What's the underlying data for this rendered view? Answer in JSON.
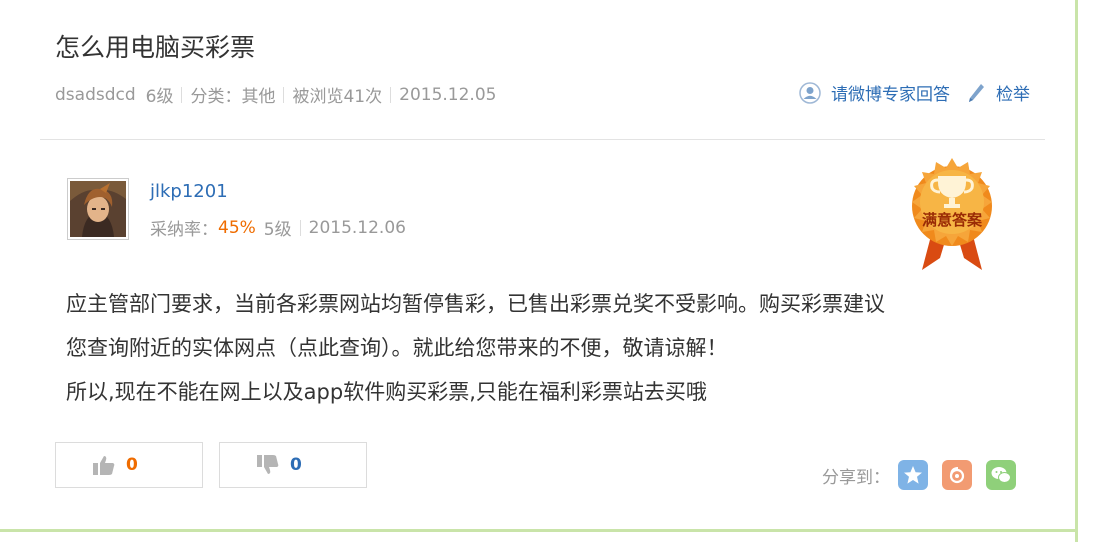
{
  "question": {
    "title": "怎么用电脑买彩票",
    "author": "dsadsdcd",
    "author_level": "6级",
    "category": "分类：其他",
    "views": "被浏览41次",
    "date": "2015.12.05"
  },
  "actions": {
    "ask_expert": "请微博专家回答",
    "report": "检举"
  },
  "answer": {
    "username": "jlkp1201",
    "adopt_rate_label": "采纳率：",
    "adopt_rate": "45%",
    "level": "5级",
    "date": "2015.12.06",
    "badge_text": "满意答案",
    "content_lines": [
      "应主管部门要求，当前各彩票网站均暂停售彩，已售出彩票兑奖不受影响。购买彩票建议",
      "您查询附近的实体网点（点此查询）。就此给您带来的不便，敬请谅解！",
      "所以,现在不能在网上以及app软件购买彩票,只能在福利彩票站去买哦"
    ]
  },
  "votes": {
    "up_count": "0",
    "down_count": "0"
  },
  "share": {
    "label": "分享到：",
    "icons": [
      "weibo-star-icon",
      "tencent-weibo-icon",
      "wechat-icon"
    ]
  },
  "colors": {
    "link_blue": "#2d6db5",
    "accent_orange": "#ef6c00",
    "frame_green": "#c9e4a9",
    "badge_orange": "#f08a1c"
  }
}
